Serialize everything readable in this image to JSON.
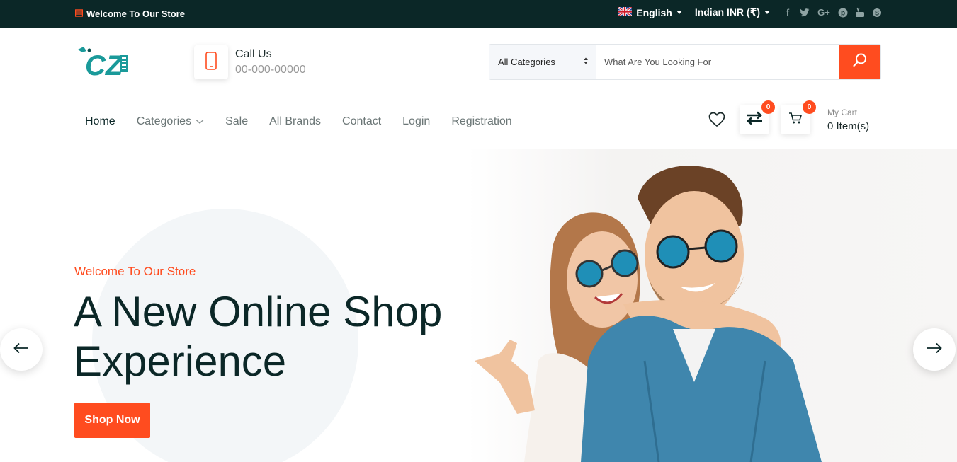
{
  "topbar": {
    "welcome": "Welcome To Our Store",
    "language": "English",
    "currency": "Indian INR (₹)",
    "social": [
      "facebook-icon",
      "twitter-icon",
      "google-plus-icon",
      "pinterest-icon",
      "youtube-icon",
      "skype-icon"
    ]
  },
  "header": {
    "logo_text": "CZ",
    "call_label": "Call Us",
    "call_number": "00-000-00000",
    "search": {
      "category": "All Categories",
      "placeholder": "What Are You Looking For"
    }
  },
  "nav": {
    "items": [
      "Home",
      "Categories",
      "Sale",
      "All Brands",
      "Contact",
      "Login",
      "Registration"
    ]
  },
  "actions": {
    "compare_count": "0",
    "cart_count": "0",
    "cart_label": "My Cart",
    "cart_items": "0 Item(s)"
  },
  "hero": {
    "subtitle": "Welcome To Our Store",
    "title_line1": "A New Online Shop",
    "title_line2": "Experience",
    "cta": "Shop Now"
  },
  "colors": {
    "accent": "#ff4c1f",
    "dark": "#0b2727",
    "logo_teal": "#1a9a9a"
  }
}
